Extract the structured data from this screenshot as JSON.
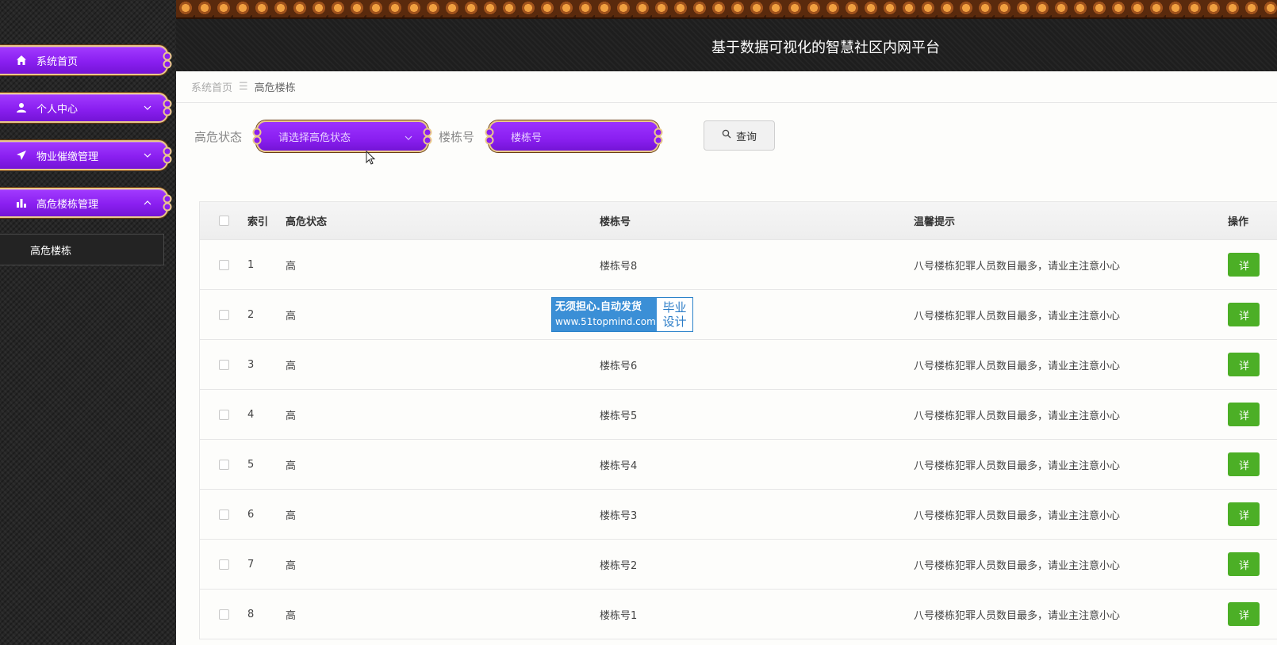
{
  "app": {
    "title": "基于数据可视化的智慧社区内网平台"
  },
  "sidebar": {
    "items": [
      {
        "label": "系统首页",
        "icon": "home-icon",
        "has_chevron": false
      },
      {
        "label": "个人中心",
        "icon": "user-icon",
        "has_chevron": true,
        "expanded": false
      },
      {
        "label": "物业催缴管理",
        "icon": "paper-plane-icon",
        "has_chevron": true,
        "expanded": false
      },
      {
        "label": "高危楼栋管理",
        "icon": "bar-chart-icon",
        "has_chevron": true,
        "expanded": true
      }
    ],
    "submenu": {
      "label": "高危楼栋"
    }
  },
  "breadcrumb": {
    "home": "系统首页",
    "separator": "☰",
    "current": "高危楼栋"
  },
  "search": {
    "state_label": "高危状态",
    "state_placeholder": "请选择高危状态",
    "building_label": "楼栋号",
    "building_placeholder": "楼栋号",
    "query_button": "查询"
  },
  "table": {
    "headers": {
      "index": "索引",
      "state": "高危状态",
      "building": "楼栋号",
      "tip": "温馨提示",
      "op": "操作"
    },
    "rows": [
      {
        "index": "1",
        "state": "高",
        "building": "楼栋号8",
        "tip": "八号楼栋犯罪人员数目最多，请业主注意小心",
        "op": "详"
      },
      {
        "index": "2",
        "state": "高",
        "building": "",
        "tip": "八号楼栋犯罪人员数目最多，请业主注意小心",
        "op": "详"
      },
      {
        "index": "3",
        "state": "高",
        "building": "楼栋号6",
        "tip": "八号楼栋犯罪人员数目最多，请业主注意小心",
        "op": "详"
      },
      {
        "index": "4",
        "state": "高",
        "building": "楼栋号5",
        "tip": "八号楼栋犯罪人员数目最多，请业主注意小心",
        "op": "详"
      },
      {
        "index": "5",
        "state": "高",
        "building": "楼栋号4",
        "tip": "八号楼栋犯罪人员数目最多，请业主注意小心",
        "op": "详"
      },
      {
        "index": "6",
        "state": "高",
        "building": "楼栋号3",
        "tip": "八号楼栋犯罪人员数目最多，请业主注意小心",
        "op": "详"
      },
      {
        "index": "7",
        "state": "高",
        "building": "楼栋号2",
        "tip": "八号楼栋犯罪人员数目最多，请业主注意小心",
        "op": "详"
      },
      {
        "index": "8",
        "state": "高",
        "building": "楼栋号1",
        "tip": "八号楼栋犯罪人员数目最多，请业主注意小心",
        "op": "详"
      }
    ]
  },
  "watermark": {
    "line1": "无须担心.自动发货",
    "line2": "www.51topmind.com",
    "right1": "毕业",
    "right2": "设计"
  },
  "colors": {
    "menu_purple": "#8a1ff0",
    "gold_border": "#e9c88a",
    "detail_green": "#4caf26"
  }
}
